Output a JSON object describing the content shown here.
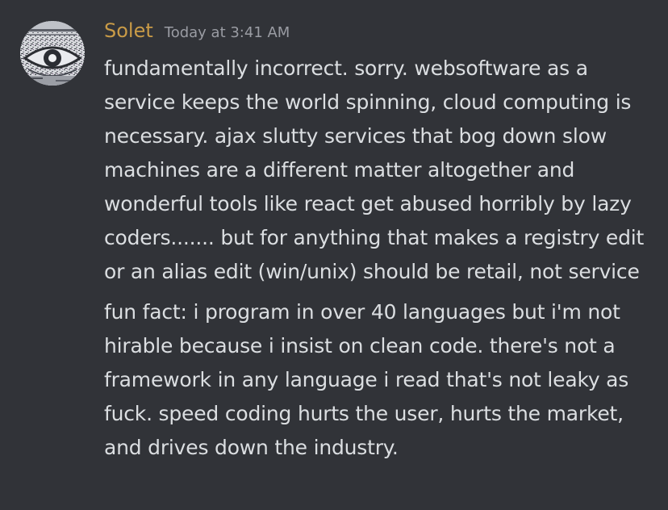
{
  "message": {
    "author": "Solet",
    "timestamp": "Today at 3:41 AM",
    "lines": [
      "fundamentally incorrect. sorry. websoftware as a service keeps the world spinning, cloud computing is necessary. ajax slutty services that bog down slow machines are a different matter altogether and wonderful tools like react get abused horribly by lazy coders....... but for anything that makes a registry edit or an alias edit (win/unix) should be retail, not service",
      "fun fact: i program in over 40 languages but i'm not hirable because i insist on clean code. there's not a framework in any language i read that's not leaky as fuck. speed coding hurts the user, hurts the market, and drives down the industry."
    ]
  },
  "colors": {
    "background": "#313338",
    "username": "#c99b47",
    "timestamp": "#9a9ca3",
    "text": "#dbdee1"
  },
  "icons": {
    "avatar": "eye-avatar"
  }
}
